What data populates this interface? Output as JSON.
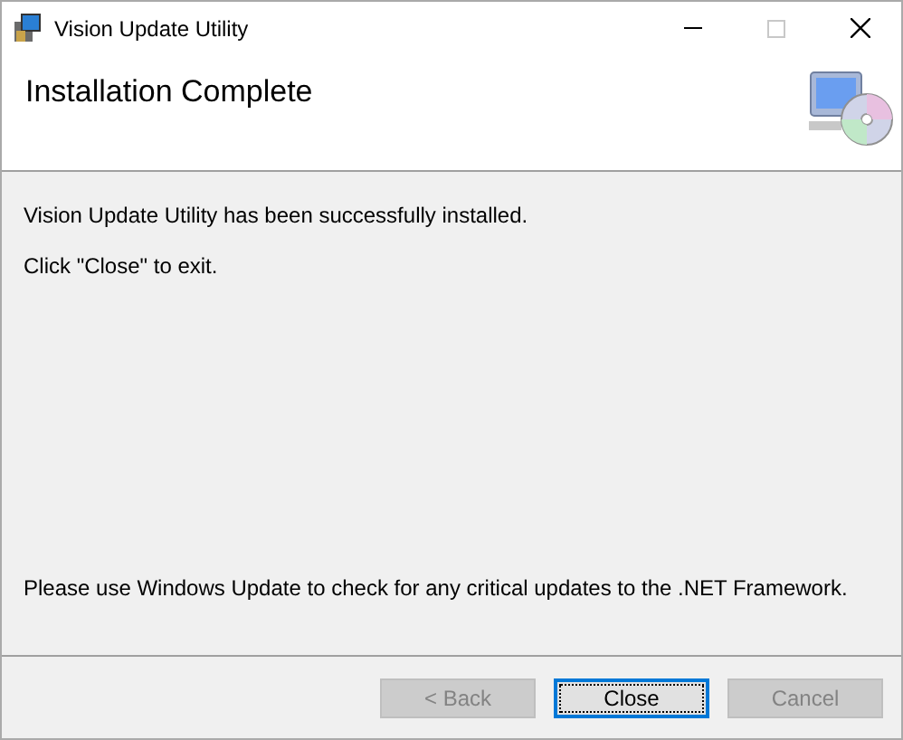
{
  "window": {
    "title": "Vision Update Utility"
  },
  "header": {
    "title": "Installation Complete"
  },
  "messages": [
    "Vision Update Utility has been successfully installed.",
    "Click \"Close\" to exit."
  ],
  "footer_note": "Please use Windows Update to check for any critical updates to the .NET Framework.",
  "buttons": [
    {
      "label": "< Back",
      "disabled": true,
      "default": false
    },
    {
      "label": "Close",
      "disabled": false,
      "default": true
    },
    {
      "label": "Cancel",
      "disabled": true,
      "default": false
    }
  ]
}
